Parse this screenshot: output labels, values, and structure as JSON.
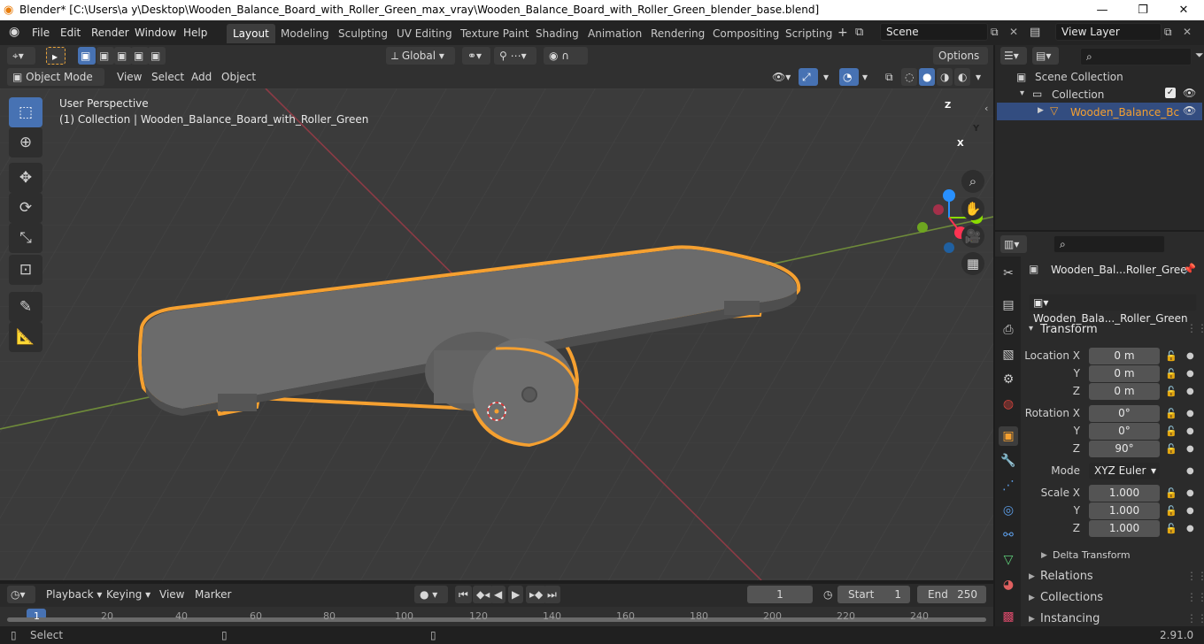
{
  "window": {
    "title": "Blender* [C:\\Users\\a y\\Desktop\\Wooden_Balance_Board_with_Roller_Green_max_vray\\Wooden_Balance_Board_with_Roller_Green_blender_base.blend]",
    "minimize": "—",
    "maximize": "❐",
    "close": "✕"
  },
  "menubar": {
    "items": [
      "File",
      "Edit",
      "Render",
      "Window",
      "Help"
    ],
    "workspaces": [
      "Layout",
      "Modeling",
      "Sculpting",
      "UV Editing",
      "Texture Paint",
      "Shading",
      "Animation",
      "Rendering",
      "Compositing",
      "Scripting"
    ],
    "active_workspace": "Layout",
    "scene": "Scene",
    "view_layer": "View Layer"
  },
  "viewport_header": {
    "orientation": "Global",
    "options": "Options",
    "mode": "Object Mode",
    "menus": [
      "View",
      "Select",
      "Add",
      "Object"
    ]
  },
  "viewport": {
    "perspective": "User Perspective",
    "collection_info": "(1) Collection | Wooden_Balance_Board_with_Roller_Green",
    "gizmo": {
      "z": "Z",
      "y": "Y",
      "x": "X"
    },
    "colors": {
      "x_axis": "#ff3352",
      "y_axis": "#8bdc00",
      "z_axis": "#2890ff",
      "selection": "#f5a030"
    }
  },
  "outliner": {
    "scene_collection": "Scene Collection",
    "collection": "Collection",
    "object": "Wooden_Balance_Bc"
  },
  "properties": {
    "object_name": "Wooden_Bal...Roller_Gree",
    "data_name": "Wooden_Bala..._Roller_Green",
    "transform_label": "Transform",
    "location_label": "Location X",
    "rotation_label": "Rotation X",
    "scale_label": "Scale X",
    "y_label": "Y",
    "z_label": "Z",
    "location": [
      "0 m",
      "0 m",
      "0 m"
    ],
    "rotation": [
      "0°",
      "0°",
      "90°"
    ],
    "mode_label": "Mode",
    "mode_value": "XYZ Euler",
    "scale": [
      "1.000",
      "1.000",
      "1.000"
    ],
    "delta_transform": "Delta Transform",
    "sections": [
      "Relations",
      "Collections",
      "Instancing"
    ]
  },
  "timeline": {
    "menus": [
      "Playback",
      "Keying",
      "View",
      "Marker"
    ],
    "current_frame": "1",
    "start_label": "Start",
    "start": "1",
    "end_label": "End",
    "end": "250",
    "ruler": [
      "1",
      "20",
      "40",
      "60",
      "80",
      "100",
      "120",
      "140",
      "160",
      "180",
      "200",
      "220",
      "240"
    ]
  },
  "statusbar": {
    "action": "Select",
    "version": "2.91.0"
  }
}
